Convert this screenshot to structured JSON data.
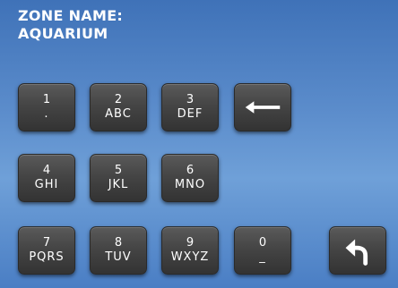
{
  "zone": {
    "label": "ZONE NAME:",
    "value": "AQUARIUM"
  },
  "keypad": {
    "keys": [
      {
        "digit": "1",
        "letters": "."
      },
      {
        "digit": "2",
        "letters": "ABC"
      },
      {
        "digit": "3",
        "letters": "DEF"
      },
      {
        "digit": "4",
        "letters": "GHI"
      },
      {
        "digit": "5",
        "letters": "JKL"
      },
      {
        "digit": "6",
        "letters": "MNO"
      },
      {
        "digit": "7",
        "letters": "PQRS"
      },
      {
        "digit": "8",
        "letters": "TUV"
      },
      {
        "digit": "9",
        "letters": "WXYZ"
      },
      {
        "digit": "0",
        "letters": "_"
      }
    ],
    "backspace_icon": "backspace-arrow-left-icon",
    "back_icon": "return-back-arrow-icon"
  },
  "colors": {
    "background_top": "#3f72b8",
    "background_bottom": "#6fa0d8",
    "key": "#454545",
    "text": "#ffffff"
  }
}
